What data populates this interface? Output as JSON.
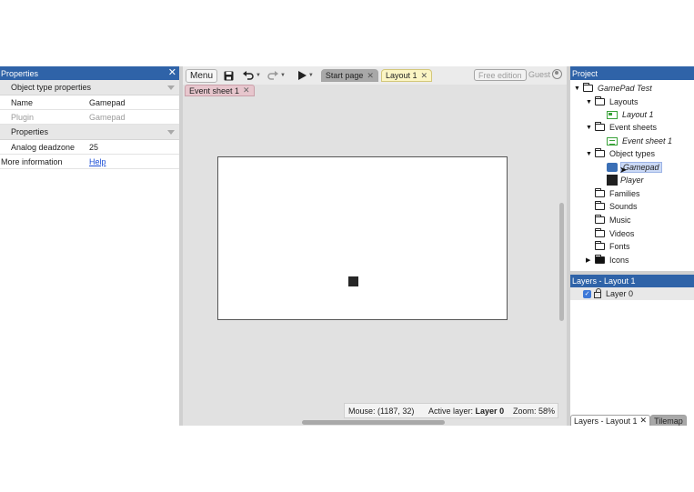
{
  "properties": {
    "title": "Properties",
    "close_glyph": "✕",
    "section1": "Object type properties",
    "rows1": [
      {
        "key": "Name",
        "value": "Gamepad"
      },
      {
        "key": "Plugin",
        "value": "Gamepad"
      }
    ],
    "section2": "Properties",
    "rows2": [
      {
        "key": "Analog deadzone",
        "value": "25"
      },
      {
        "key": "More information",
        "value": "Help"
      }
    ]
  },
  "toolbar": {
    "menu_label": "Menu",
    "tabs": [
      {
        "label": "Start page"
      },
      {
        "label": "Layout 1"
      }
    ],
    "free_edition": "Free edition",
    "guest": "Guest",
    "close_glyph": "✕"
  },
  "editor": {
    "sub_tab": "Event sheet 1"
  },
  "status": {
    "mouse": "Mouse: (1187, 32)",
    "active_layer_label": "Active layer:",
    "active_layer_value": "Layer 0",
    "zoom": "Zoom: 58%"
  },
  "project": {
    "title": "Project",
    "root": "GamePad Test",
    "layouts": "Layouts",
    "layout1": "Layout 1",
    "event_sheets": "Event sheets",
    "event_sheet1": "Event sheet 1",
    "object_types": "Object types",
    "gamepad": "Gamepad",
    "player": "Player",
    "families": "Families",
    "sounds": "Sounds",
    "music": "Music",
    "videos": "Videos",
    "fonts": "Fonts",
    "icons": "Icons"
  },
  "layers": {
    "title": "Layers - Layout 1",
    "layer0": "Layer 0",
    "tab_layers": "Layers - Layout 1",
    "tab_tilemap": "Tilemap",
    "close_glyph": "✕"
  },
  "colors": {
    "title_bar": "#2f63a8",
    "active_tab": "#fbf5c4",
    "event_tab": "#e7c6cd"
  },
  "icons": [
    "save-icon",
    "undo-icon",
    "redo-icon",
    "play-icon",
    "user-icon",
    "folder-icon",
    "layout-icon",
    "event-sheet-icon",
    "gamepad-icon",
    "lock-icon",
    "checkbox-icon"
  ]
}
